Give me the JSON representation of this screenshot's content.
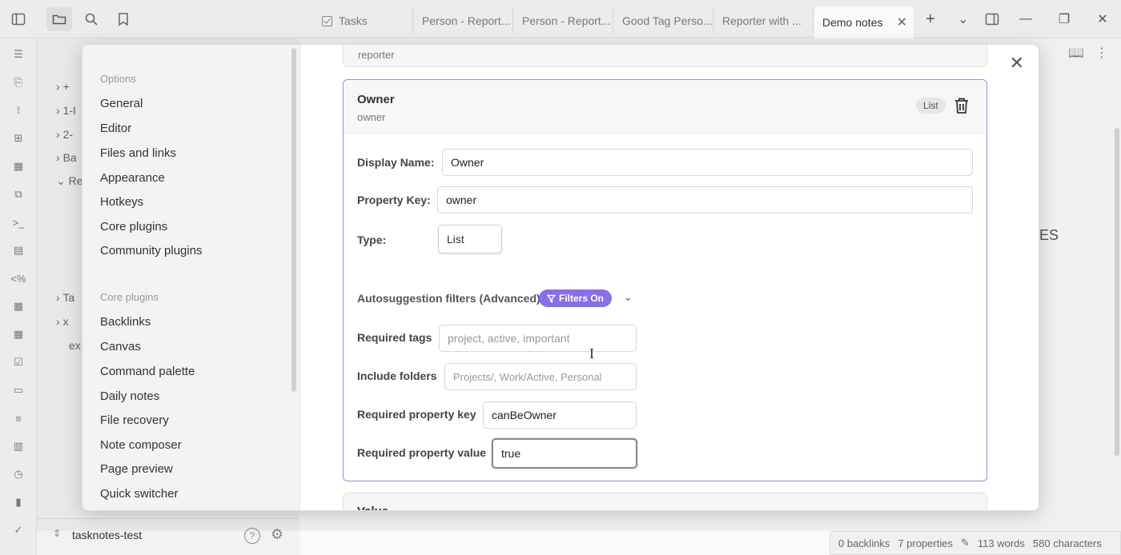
{
  "tabs": [
    {
      "label": "Tasks"
    },
    {
      "label": "Person - Report..."
    },
    {
      "label": "Person - Report..."
    },
    {
      "label": "Good Tag Perso..."
    },
    {
      "label": "Reporter with ..."
    },
    {
      "label": "Demo notes",
      "active": true
    }
  ],
  "new_tab_label": "+",
  "bg_sidebar": {
    "items": [
      "+",
      "1-I",
      "2-",
      "Ba",
      "Re",
      "Ta",
      "x",
      "ex"
    ]
  },
  "bg_editor_text": "ES",
  "vault": {
    "name": "tasknotes-test",
    "help": "?"
  },
  "status": {
    "backlinks": "0 backlinks",
    "properties": "7 properties",
    "words": "113 words",
    "characters": "580 characters"
  },
  "settings_nav": {
    "options_heading": "Options",
    "options": [
      "General",
      "Editor",
      "Files and links",
      "Appearance",
      "Hotkeys",
      "Core plugins",
      "Community plugins"
    ],
    "core_heading": "Core plugins",
    "core": [
      "Backlinks",
      "Canvas",
      "Command palette",
      "Daily notes",
      "File recovery",
      "Note composer",
      "Page preview",
      "Quick switcher"
    ]
  },
  "prev_card": {
    "key": "reporter"
  },
  "card": {
    "title": "Owner",
    "key": "owner",
    "type_badge": "List",
    "display_name_label": "Display Name:",
    "display_name_value": "Owner",
    "property_key_label": "Property Key:",
    "property_key_value": "owner",
    "type_label": "Type:",
    "type_value": "List",
    "autosuggest_label": "Autosuggestion filters (Advanced)",
    "filters_badge": "Filters On",
    "required_tags_label": "Required tags",
    "required_tags_placeholder": "project, active, important",
    "include_folders_label": "Include folders",
    "include_folders_placeholder": "Projects/, Work/Active, Personal",
    "req_prop_key_label": "Required property key",
    "req_prop_key_value": "canBeOwner",
    "req_prop_value_label": "Required property value",
    "req_prop_value_value": "true"
  },
  "next_card": {
    "title": "Value"
  },
  "colors": {
    "accent": "#8b6de8",
    "card_border": "#9b8ae6"
  }
}
